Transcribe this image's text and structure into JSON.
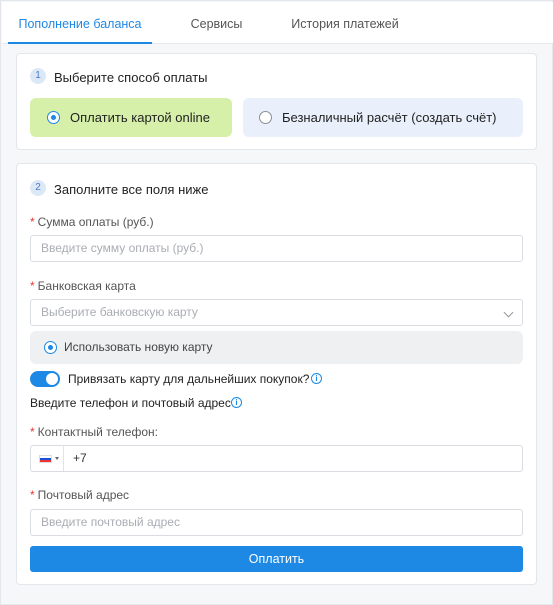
{
  "tabs": [
    {
      "label": "Пополнение баланса",
      "active": true
    },
    {
      "label": "Сервисы",
      "active": false
    },
    {
      "label": "История платежей",
      "active": false
    }
  ],
  "step1": {
    "number": "1",
    "title": "Выберите способ оплаты",
    "options": [
      {
        "label": "Оплатить картой online",
        "selected": true
      },
      {
        "label": "Безналичный расчёт (создать счёт)",
        "selected": false
      }
    ]
  },
  "step2": {
    "number": "2",
    "title": "Заполните все поля ниже",
    "amount": {
      "required_mark": "*",
      "label": "Сумма оплаты (руб.)",
      "placeholder": "Введите сумму оплаты (руб.)"
    },
    "bank_card": {
      "required_mark": "*",
      "label": "Банковская карта",
      "placeholder": "Выберите банковскую карту"
    },
    "new_card_option": {
      "label": "Использовать новую карту",
      "selected": true
    },
    "bind_card": {
      "label": "Привязать карту для дальнейших покупок?",
      "enabled": true
    },
    "contact_note": "Введите телефон и почтовый адрес",
    "phone": {
      "required_mark": "*",
      "label": "Контактный телефон",
      "label_suffix": ":",
      "value": "+7"
    },
    "email": {
      "required_mark": "*",
      "label": "Почтовый адрес",
      "placeholder": "Введите почтовый адрес"
    },
    "submit_label": "Оплатить"
  },
  "colors": {
    "accent": "#1e88e5",
    "selected_option_bg": "#d6f0a9",
    "unselected_option_bg": "#e9f0fb",
    "required": "#e53935"
  },
  "icons": {
    "info": "info-icon",
    "flag": "russia-flag-icon",
    "chevron": "chevron-down-icon"
  }
}
